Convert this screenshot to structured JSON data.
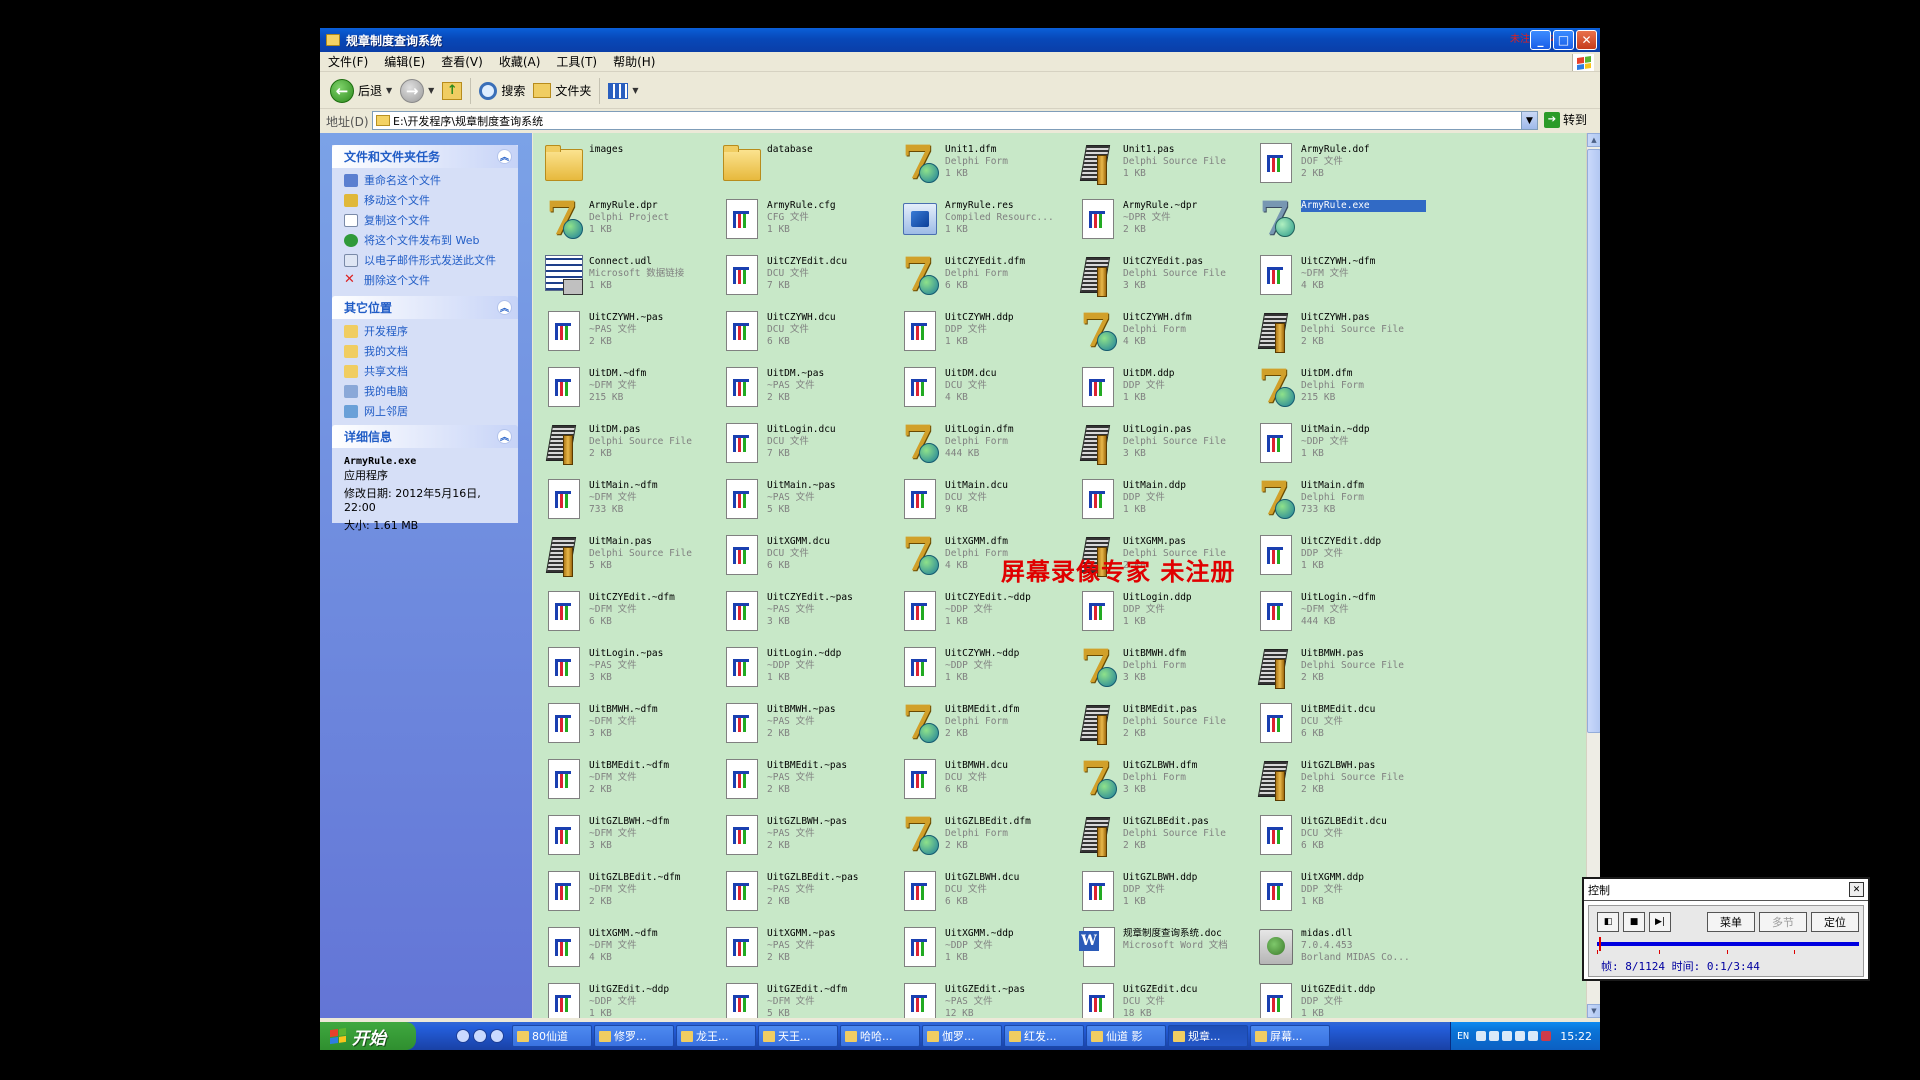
{
  "window": {
    "title": "规章制度查询系统",
    "registration_mark": "未注册版本"
  },
  "menu": [
    "文件(F)",
    "编辑(E)",
    "查看(V)",
    "收藏(A)",
    "工具(T)",
    "帮助(H)"
  ],
  "toolbar": {
    "back_label": "后退",
    "search_label": "搜索",
    "folders_label": "文件夹"
  },
  "address": {
    "label": "地址(D)",
    "value": "E:\\开发程序\\规章制度查询系统",
    "go_label": "转到"
  },
  "taskpane": {
    "file_tasks": {
      "title": "文件和文件夹任务",
      "items": [
        "重命名这个文件",
        "移动这个文件",
        "复制这个文件",
        "将这个文件发布到 Web",
        "以电子邮件形式发送此文件",
        "删除这个文件"
      ]
    },
    "other_places": {
      "title": "其它位置",
      "items": [
        "开发程序",
        "我的文档",
        "共享文档",
        "我的电脑",
        "网上邻居"
      ]
    },
    "details": {
      "title": "详细信息",
      "name": "ArmyRule.exe",
      "type": "应用程序",
      "modified": "修改日期: 2012年5月16日, 22:00",
      "size": "大小: 1.61 MB"
    }
  },
  "files": [
    {
      "name": "images",
      "type": "",
      "size": "",
      "icon": "folder"
    },
    {
      "name": "database",
      "type": "",
      "size": "",
      "icon": "folder"
    },
    {
      "name": "Unit1.dfm",
      "type": "Delphi Form",
      "size": "1 KB",
      "icon": "delphi"
    },
    {
      "name": "Unit1.pas",
      "type": "Delphi Source File",
      "size": "1 KB",
      "icon": "pas"
    },
    {
      "name": "ArmyRule.dof",
      "type": "DOF 文件",
      "size": "2 KB",
      "icon": "doc"
    },
    {
      "name": "ArmyRule.dpr",
      "type": "Delphi Project",
      "size": "1 KB",
      "icon": "delphi"
    },
    {
      "name": "ArmyRule.cfg",
      "type": "CFG 文件",
      "size": "1 KB",
      "icon": "doc"
    },
    {
      "name": "ArmyRule.res",
      "type": "Compiled Resourc...",
      "size": "1 KB",
      "icon": "res"
    },
    {
      "name": "ArmyRule.~dpr",
      "type": "~DPR 文件",
      "size": "2 KB",
      "icon": "doc"
    },
    {
      "name": "ArmyRule.exe",
      "type": "",
      "size": "",
      "icon": "exe",
      "selected": true
    },
    {
      "name": "Connect.udl",
      "type": "Microsoft 数据链接",
      "size": "1 KB",
      "icon": "udl"
    },
    {
      "name": "UitCZYEdit.dcu",
      "type": "DCU 文件",
      "size": "7 KB",
      "icon": "doc"
    },
    {
      "name": "UitCZYEdit.dfm",
      "type": "Delphi Form",
      "size": "6 KB",
      "icon": "delphi"
    },
    {
      "name": "UitCZYEdit.pas",
      "type": "Delphi Source File",
      "size": "3 KB",
      "icon": "pas"
    },
    {
      "name": "UitCZYWH.~dfm",
      "type": "~DFM 文件",
      "size": "4 KB",
      "icon": "doc"
    },
    {
      "name": "UitCZYWH.~pas",
      "type": "~PAS 文件",
      "size": "2 KB",
      "icon": "doc"
    },
    {
      "name": "UitCZYWH.dcu",
      "type": "DCU 文件",
      "size": "6 KB",
      "icon": "doc"
    },
    {
      "name": "UitCZYWH.ddp",
      "type": "DDP 文件",
      "size": "1 KB",
      "icon": "doc"
    },
    {
      "name": "UitCZYWH.dfm",
      "type": "Delphi Form",
      "size": "4 KB",
      "icon": "delphi"
    },
    {
      "name": "UitCZYWH.pas",
      "type": "Delphi Source File",
      "size": "2 KB",
      "icon": "pas"
    },
    {
      "name": "UitDM.~dfm",
      "type": "~DFM 文件",
      "size": "215 KB",
      "icon": "doc"
    },
    {
      "name": "UitDM.~pas",
      "type": "~PAS 文件",
      "size": "2 KB",
      "icon": "doc"
    },
    {
      "name": "UitDM.dcu",
      "type": "DCU 文件",
      "size": "4 KB",
      "icon": "doc"
    },
    {
      "name": "UitDM.ddp",
      "type": "DDP 文件",
      "size": "1 KB",
      "icon": "doc"
    },
    {
      "name": "UitDM.dfm",
      "type": "Delphi Form",
      "size": "215 KB",
      "icon": "delphi"
    },
    {
      "name": "UitDM.pas",
      "type": "Delphi Source File",
      "size": "2 KB",
      "icon": "pas"
    },
    {
      "name": "UitLogin.dcu",
      "type": "DCU 文件",
      "size": "7 KB",
      "icon": "doc"
    },
    {
      "name": "UitLogin.dfm",
      "type": "Delphi Form",
      "size": "444 KB",
      "icon": "delphi"
    },
    {
      "name": "UitLogin.pas",
      "type": "Delphi Source File",
      "size": "3 KB",
      "icon": "pas"
    },
    {
      "name": "UitMain.~ddp",
      "type": "~DDP 文件",
      "size": "1 KB",
      "icon": "doc"
    },
    {
      "name": "UitMain.~dfm",
      "type": "~DFM 文件",
      "size": "733 KB",
      "icon": "doc"
    },
    {
      "name": "UitMain.~pas",
      "type": "~PAS 文件",
      "size": "5 KB",
      "icon": "doc"
    },
    {
      "name": "UitMain.dcu",
      "type": "DCU 文件",
      "size": "9 KB",
      "icon": "doc"
    },
    {
      "name": "UitMain.ddp",
      "type": "DDP 文件",
      "size": "1 KB",
      "icon": "doc"
    },
    {
      "name": "UitMain.dfm",
      "type": "Delphi Form",
      "size": "733 KB",
      "icon": "delphi"
    },
    {
      "name": "UitMain.pas",
      "type": "Delphi Source File",
      "size": "5 KB",
      "icon": "pas"
    },
    {
      "name": "UitXGMM.dcu",
      "type": "DCU 文件",
      "size": "6 KB",
      "icon": "doc"
    },
    {
      "name": "UitXGMM.dfm",
      "type": "Delphi Form",
      "size": "4 KB",
      "icon": "delphi"
    },
    {
      "name": "UitXGMM.pas",
      "type": "Delphi Source File",
      "size": "2 KB",
      "icon": "pas"
    },
    {
      "name": "UitCZYEdit.ddp",
      "type": "DDP 文件",
      "size": "1 KB",
      "icon": "doc"
    },
    {
      "name": "UitCZYEdit.~dfm",
      "type": "~DFM 文件",
      "size": "6 KB",
      "icon": "doc"
    },
    {
      "name": "UitCZYEdit.~pas",
      "type": "~PAS 文件",
      "size": "3 KB",
      "icon": "doc"
    },
    {
      "name": "UitCZYEdit.~ddp",
      "type": "~DDP 文件",
      "size": "1 KB",
      "icon": "doc"
    },
    {
      "name": "UitLogin.ddp",
      "type": "DDP 文件",
      "size": "1 KB",
      "icon": "doc"
    },
    {
      "name": "UitLogin.~dfm",
      "type": "~DFM 文件",
      "size": "444 KB",
      "icon": "doc"
    },
    {
      "name": "UitLogin.~pas",
      "type": "~PAS 文件",
      "size": "3 KB",
      "icon": "doc"
    },
    {
      "name": "UitLogin.~ddp",
      "type": "~DDP 文件",
      "size": "1 KB",
      "icon": "doc"
    },
    {
      "name": "UitCZYWH.~ddp",
      "type": "~DDP 文件",
      "size": "1 KB",
      "icon": "doc"
    },
    {
      "name": "UitBMWH.dfm",
      "type": "Delphi Form",
      "size": "3 KB",
      "icon": "delphi"
    },
    {
      "name": "UitBMWH.pas",
      "type": "Delphi Source File",
      "size": "2 KB",
      "icon": "pas"
    },
    {
      "name": "UitBMWH.~dfm",
      "type": "~DFM 文件",
      "size": "3 KB",
      "icon": "doc"
    },
    {
      "name": "UitBMWH.~pas",
      "type": "~PAS 文件",
      "size": "2 KB",
      "icon": "doc"
    },
    {
      "name": "UitBMEdit.dfm",
      "type": "Delphi Form",
      "size": "2 KB",
      "icon": "delphi"
    },
    {
      "name": "UitBMEdit.pas",
      "type": "Delphi Source File",
      "size": "2 KB",
      "icon": "pas"
    },
    {
      "name": "UitBMEdit.dcu",
      "type": "DCU 文件",
      "size": "6 KB",
      "icon": "doc"
    },
    {
      "name": "UitBMEdit.~dfm",
      "type": "~DFM 文件",
      "size": "2 KB",
      "icon": "doc"
    },
    {
      "name": "UitBMEdit.~pas",
      "type": "~PAS 文件",
      "size": "2 KB",
      "icon": "doc"
    },
    {
      "name": "UitBMWH.dcu",
      "type": "DCU 文件",
      "size": "6 KB",
      "icon": "doc"
    },
    {
      "name": "UitGZLBWH.dfm",
      "type": "Delphi Form",
      "size": "3 KB",
      "icon": "delphi"
    },
    {
      "name": "UitGZLBWH.pas",
      "type": "Delphi Source File",
      "size": "2 KB",
      "icon": "pas"
    },
    {
      "name": "UitGZLBWH.~dfm",
      "type": "~DFM 文件",
      "size": "3 KB",
      "icon": "doc"
    },
    {
      "name": "UitGZLBWH.~pas",
      "type": "~PAS 文件",
      "size": "2 KB",
      "icon": "doc"
    },
    {
      "name": "UitGZLBEdit.dfm",
      "type": "Delphi Form",
      "size": "2 KB",
      "icon": "delphi"
    },
    {
      "name": "UitGZLBEdit.pas",
      "type": "Delphi Source File",
      "size": "2 KB",
      "icon": "pas"
    },
    {
      "name": "UitGZLBEdit.dcu",
      "type": "DCU 文件",
      "size": "6 KB",
      "icon": "doc"
    },
    {
      "name": "UitGZLBEdit.~dfm",
      "type": "~DFM 文件",
      "size": "2 KB",
      "icon": "doc"
    },
    {
      "name": "UitGZLBEdit.~pas",
      "type": "~PAS 文件",
      "size": "2 KB",
      "icon": "doc"
    },
    {
      "name": "UitGZLBWH.dcu",
      "type": "DCU 文件",
      "size": "6 KB",
      "icon": "doc"
    },
    {
      "name": "UitGZLBWH.ddp",
      "type": "DDP 文件",
      "size": "1 KB",
      "icon": "doc"
    },
    {
      "name": "UitXGMM.ddp",
      "type": "DDP 文件",
      "size": "1 KB",
      "icon": "doc"
    },
    {
      "name": "UitXGMM.~dfm",
      "type": "~DFM 文件",
      "size": "4 KB",
      "icon": "doc"
    },
    {
      "name": "UitXGMM.~pas",
      "type": "~PAS 文件",
      "size": "2 KB",
      "icon": "doc"
    },
    {
      "name": "UitXGMM.~ddp",
      "type": "~DDP 文件",
      "size": "1 KB",
      "icon": "doc"
    },
    {
      "name": "规章制度查询系统.doc",
      "type": "Microsoft Word 文档",
      "size": "",
      "icon": "word"
    },
    {
      "name": "midas.dll",
      "type": "7.0.4.453",
      "size": "Borland MIDAS Co...",
      "icon": "dll"
    },
    {
      "name": "UitGZEdit.~ddp",
      "type": "~DDP 文件",
      "size": "1 KB",
      "icon": "doc"
    },
    {
      "name": "UitGZEdit.~dfm",
      "type": "~DFM 文件",
      "size": "5 KB",
      "icon": "doc"
    },
    {
      "name": "UitGZEdit.~pas",
      "type": "~PAS 文件",
      "size": "12 KB",
      "icon": "doc"
    },
    {
      "name": "UitGZEdit.dcu",
      "type": "DCU 文件",
      "size": "18 KB",
      "icon": "doc"
    },
    {
      "name": "UitGZEdit.ddp",
      "type": "DDP 文件",
      "size": "1 KB",
      "icon": "doc"
    }
  ],
  "watermark": "屏幕录像专家  未注册",
  "taskbar": {
    "start_label": "开始",
    "tasks": [
      "80仙道",
      "修罗...",
      "龙王...",
      "天王...",
      "哈哈...",
      "伽罗...",
      "红发...",
      "仙道 影",
      "规章...",
      "屏幕..."
    ],
    "active_task": 8,
    "lang": "EN",
    "clock": "15:22"
  },
  "recorder": {
    "title": "控制",
    "menu_label": "菜单",
    "multi_label": "多节",
    "locate_label": "定位",
    "info": "帧: 8/1124 时间: 0:1/3:44",
    "progress": 0.007
  },
  "colors": {
    "titlebar": "#0a5fd8",
    "taskpane": "#7ba2e7",
    "filearea_bg": "#c8e8c8",
    "selection": "#316ac5",
    "watermark": "#e00000"
  }
}
